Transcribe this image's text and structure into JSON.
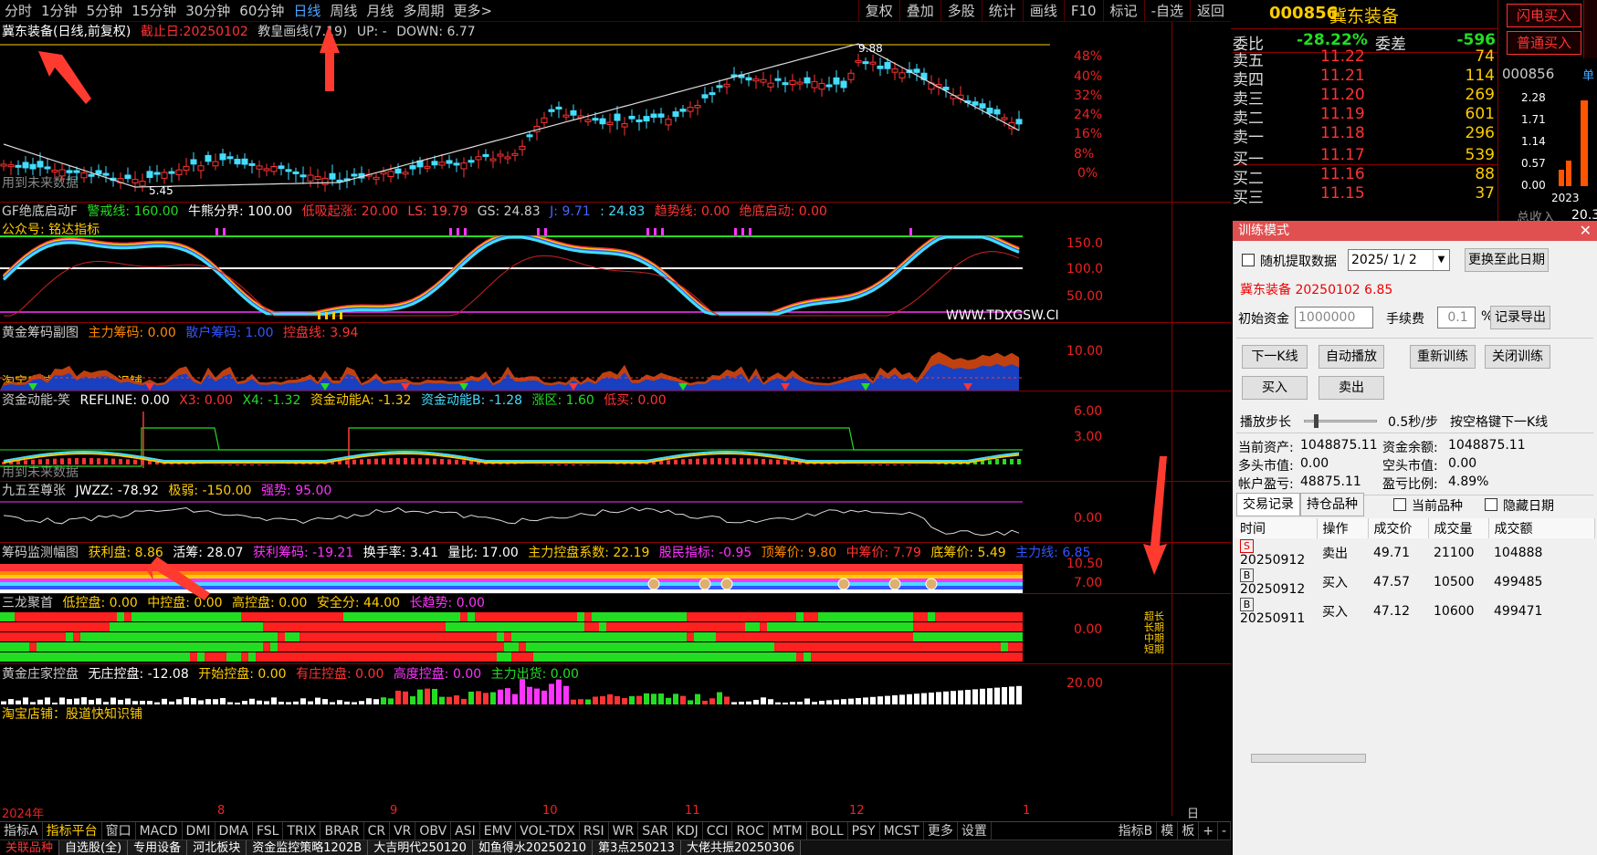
{
  "toolbar": {
    "timeframes": [
      "分时",
      "1分钟",
      "5分钟",
      "15分钟",
      "30分钟",
      "60分钟",
      "日线",
      "周线",
      "月线",
      "多周期",
      "更多>"
    ],
    "tools": [
      "复权",
      "叠加",
      "多股",
      "统计",
      "画线",
      "F10",
      "标记",
      "-自选",
      "返回"
    ]
  },
  "main": {
    "title": "冀东装备(日线,前复权)",
    "cutoff": "截止日:20250102",
    "indicator": "教皇画线(7.19)",
    "up": "UP: -",
    "down": "DOWN: 6.77",
    "future_note": "用到未来数据",
    "high_label": "9.88",
    "low_label": "5.45",
    "axis": [
      "48%",
      "40%",
      "32%",
      "24%",
      "16%",
      "8%",
      "0%"
    ]
  },
  "panel1": {
    "items": [
      "GF绝底启动F",
      "警戒线: 160.00",
      "牛熊分界: 100.00",
      "低吸起涨: 20.00",
      "LS: 19.79",
      "GS: 24.83",
      "J: 9.71",
      ": 24.83",
      "趋势线: 0.00",
      "绝底启动: 0.00"
    ],
    "note": "公众号: 铭达指标",
    "watermark": "WWW.TDXGSW.CI",
    "axis": [
      "150.0",
      "100.0",
      "50.00"
    ]
  },
  "panel2": {
    "items": [
      "黄金筹码副图",
      "主力筹码: 0.00",
      "散户筹码: 1.00",
      "控盘线: 3.94"
    ],
    "note": "淘宝店铺：股道快知识铺",
    "axis": [
      "10.00"
    ]
  },
  "panel3": {
    "items": [
      "资金动能-笑",
      "REFLINE: 0.00",
      "X3: 0.00",
      "X4: -1.32",
      "资金动能A: -1.32",
      "资金动能B: -1.28",
      "涨区: 1.60",
      "低买: 0.00"
    ],
    "note": "用到未来数据",
    "axis": [
      "6.00",
      "3.00"
    ]
  },
  "panel4": {
    "items": [
      "九五至尊张",
      "JWZZ: -78.92",
      "极弱: -150.00",
      "强势: 95.00"
    ],
    "axis": [
      "0.00"
    ]
  },
  "panel5": {
    "items": [
      "筹码监测幅图",
      "获利盘: 8.86",
      "活筹: 28.07",
      "获利筹码: -19.21",
      "换手率: 3.41",
      "量比: 17.00",
      "主力控盘系数: 22.19",
      "股民指标: -0.95",
      "顶筹价: 9.80",
      "中筹价: 7.79",
      "底筹价: 5.49",
      "主力线: 6.85"
    ],
    "axis": [
      "10.50",
      "7.00"
    ]
  },
  "panel6": {
    "items": [
      "三龙聚首",
      "低控盘: 0.00",
      "中控盘: 0.00",
      "高控盘: 0.00",
      "安全分: 44.00",
      "长趋势: 0.00"
    ],
    "right_labels": [
      "超长",
      "长期",
      "中期",
      "短期"
    ],
    "axis": [
      "0.00"
    ]
  },
  "panel7": {
    "items": [
      "黄金庄家控盘",
      "无庄控盘: -12.08",
      "开始控盘: 0.00",
      "有庄控盘: 0.00",
      "高度控盘: 0.00",
      "主力出货: 0.00"
    ],
    "note": "淘宝店铺：股道快知识铺",
    "axis": [
      "20.00"
    ]
  },
  "datebar": {
    "labels": [
      "2024年",
      "8",
      "9",
      "10",
      "11",
      "12",
      "1"
    ],
    "period": "日线"
  },
  "bottom_tabs": [
    "指标A",
    "指标平台",
    "窗口",
    "MACD",
    "DMI",
    "DMA",
    "FSL",
    "TRIX",
    "BRAR",
    "CR",
    "VR",
    "OBV",
    "ASI",
    "EMV",
    "VOL-TDX",
    "RSI",
    "WR",
    "SAR",
    "KDJ",
    "CCI",
    "ROC",
    "MTM",
    "BOLL",
    "PSY",
    "MCST",
    "更多",
    "设置"
  ],
  "bottom_right_tabs": [
    "指标B",
    "模",
    "板",
    "+",
    "-"
  ],
  "sheets": [
    "关联品种",
    "自选股(全)",
    "专用设备",
    "河北板块",
    "资金监控策略1202B",
    "大吉明代250120",
    "如鱼得水20250210",
    "第3点250213",
    "大佬共振20250306"
  ],
  "quote": {
    "code": "000856",
    "name": "冀东装备",
    "weibi_label": "委比",
    "weibi": "-28.22%",
    "weicha_label": "委差",
    "weicha": "-596",
    "asks": [
      {
        "label": "卖五",
        "price": "11.22",
        "vol": "74"
      },
      {
        "label": "卖四",
        "price": "11.21",
        "vol": "114"
      },
      {
        "label": "卖三",
        "price": "11.20",
        "vol": "269"
      },
      {
        "label": "卖二",
        "price": "11.19",
        "vol": "601"
      },
      {
        "label": "卖一",
        "price": "11.18",
        "vol": "296"
      }
    ],
    "bids": [
      {
        "label": "买一",
        "price": "11.17",
        "vol": "539"
      },
      {
        "label": "买二",
        "price": "11.16",
        "vol": "88"
      },
      {
        "label": "买三",
        "price": "11.15",
        "vol": "37"
      }
    ],
    "flash_buy": "闪电买入",
    "normal_buy": "普通买入",
    "mini": {
      "code": "000856",
      "axis": [
        "2.28",
        "1.71",
        "1.14",
        "0.57",
        "0.00"
      ],
      "year": "2023",
      "extra": "总收入",
      "extra_val": "20.3",
      "corner": "单"
    }
  },
  "training": {
    "title": "训练模式",
    "random_label": "随机提取数据",
    "date": "2025/ 1/ 2",
    "change_btn": "更换至此日期",
    "stock_info": "冀东装备  20250102  6.85",
    "init_cap_label": "初始资金",
    "init_cap": "1000000",
    "fee_label": "手续费",
    "fee": "0.1",
    "pct": "%",
    "export_btn": "记录导出",
    "btns": [
      "下一K线",
      "自动播放",
      "重新训练",
      "关闭训练",
      "买入",
      "卖出"
    ],
    "step_label": "播放步长",
    "step_value": "0.5秒/步",
    "space_hint": "按空格键下一K线",
    "assets_label": "当前资产:",
    "assets": "1048875.11",
    "balance_label": "资金余额:",
    "balance": "1048875.11",
    "long_label": "多头市值:",
    "long": "0.00",
    "short_label": "空头市值:",
    "short": "0.00",
    "pnl_label": "帐户盈亏:",
    "pnl": "48875.11",
    "ratio_label": "盈亏比例:",
    "ratio": "4.89%",
    "tabs": [
      "交易记录",
      "持仓品种"
    ],
    "current_label": "当前品种",
    "hide_label": "隐藏日期",
    "columns": [
      "时间",
      "操作",
      "成交价",
      "成交量",
      "成交额"
    ],
    "rows": [
      {
        "flag": "S",
        "time": "20250912",
        "op": "卖出",
        "price": "49.71",
        "qty": "21100",
        "amt": "104888"
      },
      {
        "flag": "B",
        "time": "20250912",
        "op": "买入",
        "price": "47.57",
        "qty": "10500",
        "amt": "499485"
      },
      {
        "flag": "B",
        "time": "20250911",
        "op": "买入",
        "price": "47.12",
        "qty": "10600",
        "amt": "499471"
      }
    ]
  }
}
